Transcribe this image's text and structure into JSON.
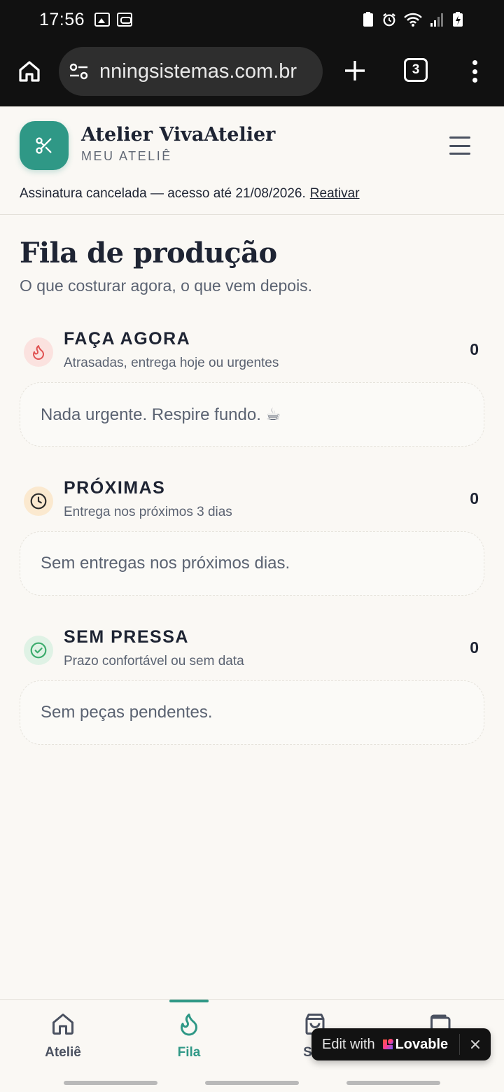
{
  "status_bar": {
    "time": "17:56"
  },
  "browser": {
    "url": "nningsistemas.com.br",
    "tab_count": "3"
  },
  "header": {
    "brand_name": "Atelier VivaAtelier",
    "brand_sub": "MEU ATELIÊ",
    "notice": "Assinatura cancelada — acesso até 21/08/2026.",
    "notice_link": "Reativar"
  },
  "main": {
    "title": "Fila de produção",
    "subtitle": "O que costurar agora, o que vem depois.",
    "sections": [
      {
        "title": "FAÇA AGORA",
        "desc": "Atrasadas, entrega hoje ou urgentes",
        "count": "0",
        "empty": "Nada urgente. Respire fundo. ☕",
        "icon": "flame-icon",
        "color": "#e05252",
        "bg": "#fbe2df"
      },
      {
        "title": "PRÓXIMAS",
        "desc": "Entrega nos próximos 3 dias",
        "count": "0",
        "empty": "Sem entregas nos próximos dias.",
        "icon": "clock-icon",
        "color": "#2b2b2b",
        "bg": "#fbe9cf"
      },
      {
        "title": "SEM PRESSA",
        "desc": "Prazo confortável ou sem data",
        "count": "0",
        "empty": "Sem peças pendentes.",
        "icon": "check-circle-icon",
        "color": "#3bab6c",
        "bg": "#dff2e5"
      }
    ]
  },
  "bottom_nav": {
    "items": [
      {
        "label": "Ateliê",
        "icon": "home-icon"
      },
      {
        "label": "Fila",
        "icon": "flame-icon",
        "active": true
      },
      {
        "label": "Sac",
        "icon": "bag-icon"
      },
      {
        "label": "",
        "icon": "wallet-icon"
      }
    ]
  },
  "lovable": {
    "text": "Edit with",
    "brand": "Lovable"
  },
  "colors": {
    "accent": "#2f9886",
    "background": "#faf8f4",
    "text": "#1e2433"
  }
}
